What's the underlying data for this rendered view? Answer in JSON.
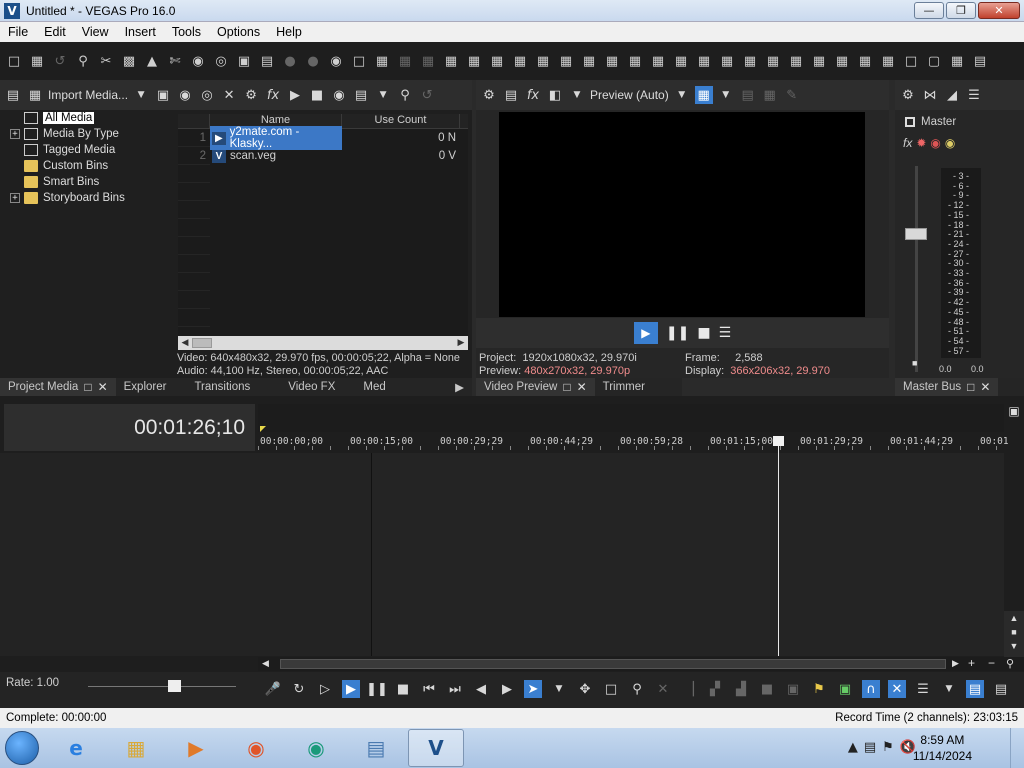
{
  "window": {
    "title": "Untitled * - VEGAS Pro 16.0",
    "logo_letter": "V"
  },
  "menu": [
    "File",
    "Edit",
    "View",
    "Insert",
    "Tools",
    "Options",
    "Help"
  ],
  "project_media": {
    "import_label": "Import Media...",
    "tree": [
      {
        "label": "All Media",
        "expander": "",
        "selected": true,
        "icon": "media"
      },
      {
        "label": "Media By Type",
        "expander": "+",
        "selected": false,
        "icon": "media"
      },
      {
        "label": "Tagged Media",
        "expander": "",
        "selected": false,
        "icon": "media"
      },
      {
        "label": "Custom Bins",
        "expander": "",
        "selected": false,
        "icon": "folder"
      },
      {
        "label": "Smart Bins",
        "expander": "",
        "selected": false,
        "icon": "folder"
      },
      {
        "label": "Storyboard Bins",
        "expander": "+",
        "selected": false,
        "icon": "folder"
      }
    ],
    "columns": {
      "name": "Name",
      "use_count": "Use Count"
    },
    "rows": [
      {
        "num": "1",
        "name": "y2mate.com - Klasky...",
        "use_count": "0",
        "extra": "N",
        "selected": true
      },
      {
        "num": "2",
        "name": "scan.veg",
        "use_count": "0",
        "extra": "V",
        "selected": false
      }
    ],
    "video_info": "Video: 640x480x32, 29.970 fps, 00:00:05;22, Alpha = None",
    "audio_info": "Audio: 44,100 Hz, Stereo, 00:00:05;22, AAC"
  },
  "left_tabs": [
    "Project Media",
    "Explorer",
    "Transitions",
    "Video FX",
    "Med"
  ],
  "preview": {
    "mode": "Preview (Auto)",
    "project_label": "Project:",
    "project_value": "1920x1080x32, 29.970i",
    "preview_label": "Preview:",
    "preview_value": "480x270x32, 29.970p",
    "frame_label": "Frame:",
    "frame_value": "2,588",
    "display_label": "Display:",
    "display_value": "366x206x32, 29.970",
    "tabs": [
      "Video Preview",
      "Trimmer"
    ]
  },
  "master": {
    "label": "Master",
    "scale": [
      "3",
      "6",
      "9",
      "12",
      "15",
      "18",
      "21",
      "24",
      "27",
      "30",
      "33",
      "36",
      "39",
      "42",
      "45",
      "48",
      "51",
      "54",
      "57"
    ],
    "left_value": "0.0",
    "right_value": "0.0",
    "tab": "Master Bus"
  },
  "timeline": {
    "timecode": "00:01:26;10",
    "ruler": [
      "00:00:00;00",
      "00:00:15;00",
      "00:00:29;29",
      "00:00:44;29",
      "00:00:59;28",
      "00:01:15;00",
      "00:01:29;29",
      "00:01:44;29",
      "00:01"
    ],
    "rate": "Rate: 1.00"
  },
  "status": {
    "left": "Complete: 00:00:00",
    "right": "Record Time (2 channels): 23:03:15"
  },
  "taskbar": {
    "time": "8:59 AM",
    "date": "11/14/2024"
  },
  "colors": {
    "accent": "#3a7fd0",
    "highlight_text": "#f08c8c",
    "panel_bg": "#1f1f1f"
  }
}
